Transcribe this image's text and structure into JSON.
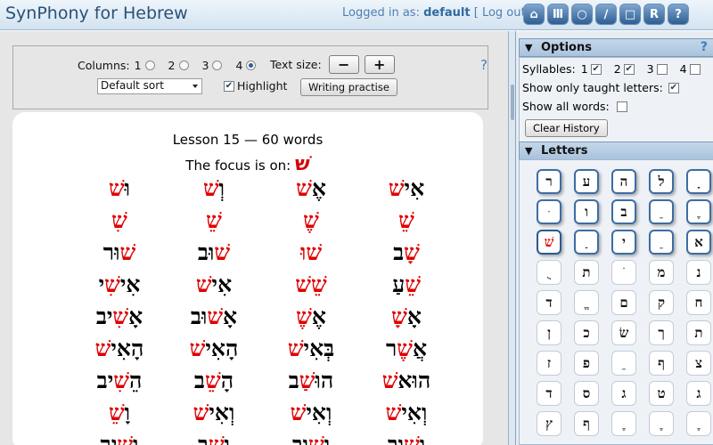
{
  "header": {
    "app_title": "SynPhony for Hebrew",
    "logged_in_label": "Logged in as:",
    "username": "default",
    "logout": "[ Log out ]",
    "nav_icons": [
      "home-icon",
      "books-icon",
      "circle-icon",
      "pencil-icon",
      "square-icon",
      "reports-icon",
      "help-icon"
    ],
    "nav_glyphs": [
      "⌂",
      "Ⅲ",
      "○",
      "∕",
      "□",
      "R",
      "?"
    ]
  },
  "controls": {
    "columns_label": "Columns:",
    "columns_options": [
      "1",
      "2",
      "3",
      "4"
    ],
    "columns_selected": "4",
    "text_size_label": "Text size:",
    "minus": "−",
    "plus": "+",
    "sort_value": "Default sort",
    "highlight_label": "Highlight",
    "highlight_checked": true,
    "writing_button": "Writing practise",
    "help": "?"
  },
  "lesson": {
    "title": "Lesson 15 — 60 words",
    "focus_label": "The focus is on:",
    "focus_letter": "שׁ",
    "rows": [
      [
        {
          "pre": "אִי",
          "hl": "שׁ",
          "post": ""
        },
        {
          "pre": "אֶ",
          "hl": "שׁ",
          "post": ""
        },
        {
          "pre": "וְ",
          "hl": "שׁ",
          "post": ""
        },
        {
          "pre": "וּ",
          "hl": "שׁ",
          "post": ""
        }
      ],
      [
        {
          "pre": "",
          "hl": "שֵׁ",
          "post": ""
        },
        {
          "pre": "",
          "hl": "שֶׁ",
          "post": ""
        },
        {
          "pre": "",
          "hl": "שֵׁ",
          "post": ""
        },
        {
          "pre": "",
          "hl": "שִׁ",
          "post": ""
        }
      ],
      [
        {
          "pre": "",
          "hl": "שָׁ",
          "post": "ב"
        },
        {
          "pre": "",
          "hl": "שׁוּ",
          "post": ""
        },
        {
          "pre": "",
          "hl": "שׁ",
          "post": "וּב"
        },
        {
          "pre": "",
          "hl": "שׁ",
          "post": "וּר"
        }
      ],
      [
        {
          "pre": "",
          "hl": "שֵׁ",
          "post": "עַ"
        },
        {
          "pre": "",
          "hl": "שֵׁשׁ",
          "post": ""
        },
        {
          "pre": "אִי",
          "hl": "שׁ",
          "post": ""
        },
        {
          "pre": "אִי",
          "hl": "שִׁ",
          "post": "י"
        }
      ],
      [
        {
          "pre": "אָ",
          "hl": "שָׁ",
          "post": ""
        },
        {
          "pre": "אֶ",
          "hl": "שֶׁ",
          "post": ""
        },
        {
          "pre": "אָ",
          "hl": "שׁ",
          "post": "וּב"
        },
        {
          "pre": "אָ",
          "hl": "שִׁ",
          "post": "יב"
        }
      ],
      [
        {
          "pre": "אֲ",
          "hl": "שֶׁ",
          "post": "ר"
        },
        {
          "pre": "בְּאִי",
          "hl": "שׁ",
          "post": ""
        },
        {
          "pre": "הָאִי",
          "hl": "שׁ",
          "post": ""
        },
        {
          "pre": "הָאִי",
          "hl": "שׁ",
          "post": ""
        }
      ],
      [
        {
          "pre": "הוּא",
          "hl": "שׁ",
          "post": ""
        },
        {
          "pre": "הוּ",
          "hl": "שַׁ",
          "post": "ב"
        },
        {
          "pre": "הָ",
          "hl": "שֵׁ",
          "post": "ב"
        },
        {
          "pre": "הֵ",
          "hl": "שִׁ",
          "post": "יב"
        }
      ],
      [
        {
          "pre": "וְאִי",
          "hl": "שׁ",
          "post": ""
        },
        {
          "pre": "וְאִי",
          "hl": "שׁ",
          "post": ""
        },
        {
          "pre": "וְאִי",
          "hl": "שׁ",
          "post": ""
        },
        {
          "pre": "וָ",
          "hl": "שֵׁ",
          "post": ""
        }
      ],
      [
        {
          "pre": "וְ",
          "hl": "שׁ",
          "post": "וּב"
        },
        {
          "pre": "וְ",
          "hl": "שׁ",
          "post": "וּב"
        },
        {
          "pre": "וְ",
          "hl": "שָׁ",
          "post": "ב"
        },
        {
          "pre": "וְ",
          "hl": "שִׁ",
          "post": "יר"
        }
      ]
    ]
  },
  "options": {
    "header": "Options",
    "help": "?",
    "syllables_label": "Syllables:",
    "syllables": [
      {
        "label": "1",
        "checked": true
      },
      {
        "label": "2",
        "checked": true
      },
      {
        "label": "3",
        "checked": false
      },
      {
        "label": "4",
        "checked": false
      }
    ],
    "taught_label": "Show only taught letters:",
    "taught_checked": true,
    "all_words_label": "Show all words:",
    "all_words_checked": false,
    "clear_history": "Clear History"
  },
  "letters": {
    "header": "Letters",
    "tiles": [
      [
        "ר",
        "ע",
        "ה",
        "ל",
        "ָ"
      ],
      [
        "ּ",
        "ו",
        "ב",
        "ֵ",
        "ֶ"
      ],
      [
        "שׁ",
        "ַ",
        "י",
        "ֵ",
        "א"
      ],
      [
        "ֻ",
        "ת",
        "ֹ",
        "מ",
        "נ"
      ],
      [
        "ד",
        "ֱ",
        "ם",
        "ק",
        "ח"
      ],
      [
        "ן",
        "כ",
        "שׂ",
        "ך",
        "ת"
      ],
      [
        "ז",
        "פ",
        "ֵ",
        "ף",
        "צ"
      ],
      [
        "ד",
        "ס",
        "ג",
        "ט",
        "ג"
      ],
      [
        "ץ",
        "ף",
        "ֶ",
        "ֶ",
        "ֶ"
      ]
    ],
    "raised_rows": 3,
    "selected": "שׁ"
  }
}
